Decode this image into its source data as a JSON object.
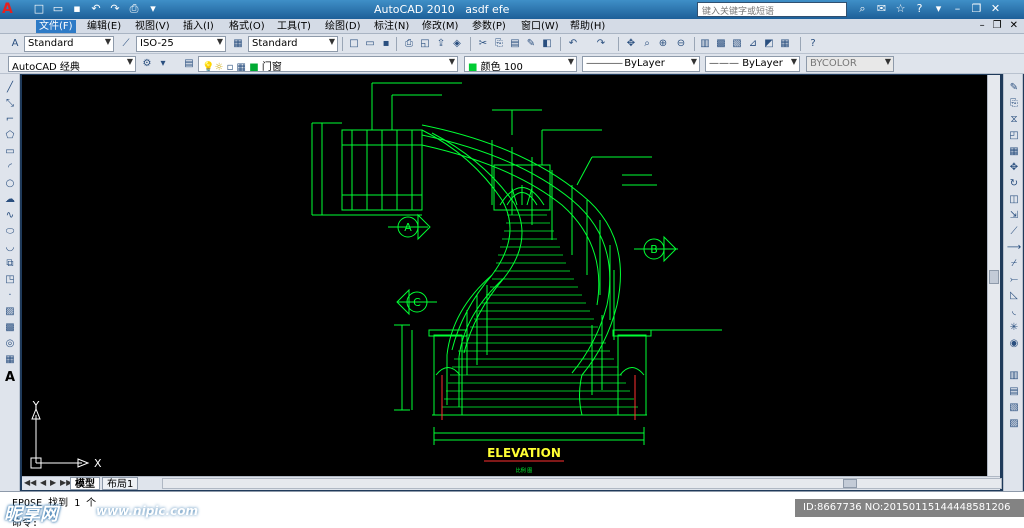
{
  "app": {
    "title": "AutoCAD 2010",
    "document": "asdf efe",
    "logo": "A",
    "search_placeholder": "键入关键字或短语"
  },
  "menu": {
    "items": [
      "文件(F)",
      "编辑(E)",
      "视图(V)",
      "插入(I)",
      "格式(O)",
      "工具(T)",
      "绘图(D)",
      "标注(N)",
      "修改(M)",
      "参数(P)",
      "窗口(W)",
      "帮助(H)"
    ]
  },
  "styles_toolbar": {
    "text_style": "Standard",
    "dim_style": "ISO-25",
    "table_style": "Standard"
  },
  "layers_toolbar": {
    "workspace": "AutoCAD 经典",
    "layer": "门窗",
    "color": "颜色 100",
    "linetype": "ByLayer",
    "lineweight": "ByLayer",
    "plotstyle": "BYCOLOR"
  },
  "drawing": {
    "title": "ELEVATION",
    "subtitle": "比例 图",
    "callouts": [
      "A",
      "B",
      "C"
    ],
    "ucs_x": "X",
    "ucs_y": "Y"
  },
  "tabs": {
    "items": [
      "模型",
      "布局1"
    ]
  },
  "command": {
    "line1": "EPOSE  找到 1 个",
    "line2": "命令:"
  },
  "watermark": {
    "logo": "昵享网",
    "url": "www.nipic.com",
    "id": "ID:8667736 NO:20150115144448581206"
  },
  "colors": {
    "cad_green": "#00ff33",
    "canvas": "#000000",
    "titlebar": "#2a6ea8"
  }
}
